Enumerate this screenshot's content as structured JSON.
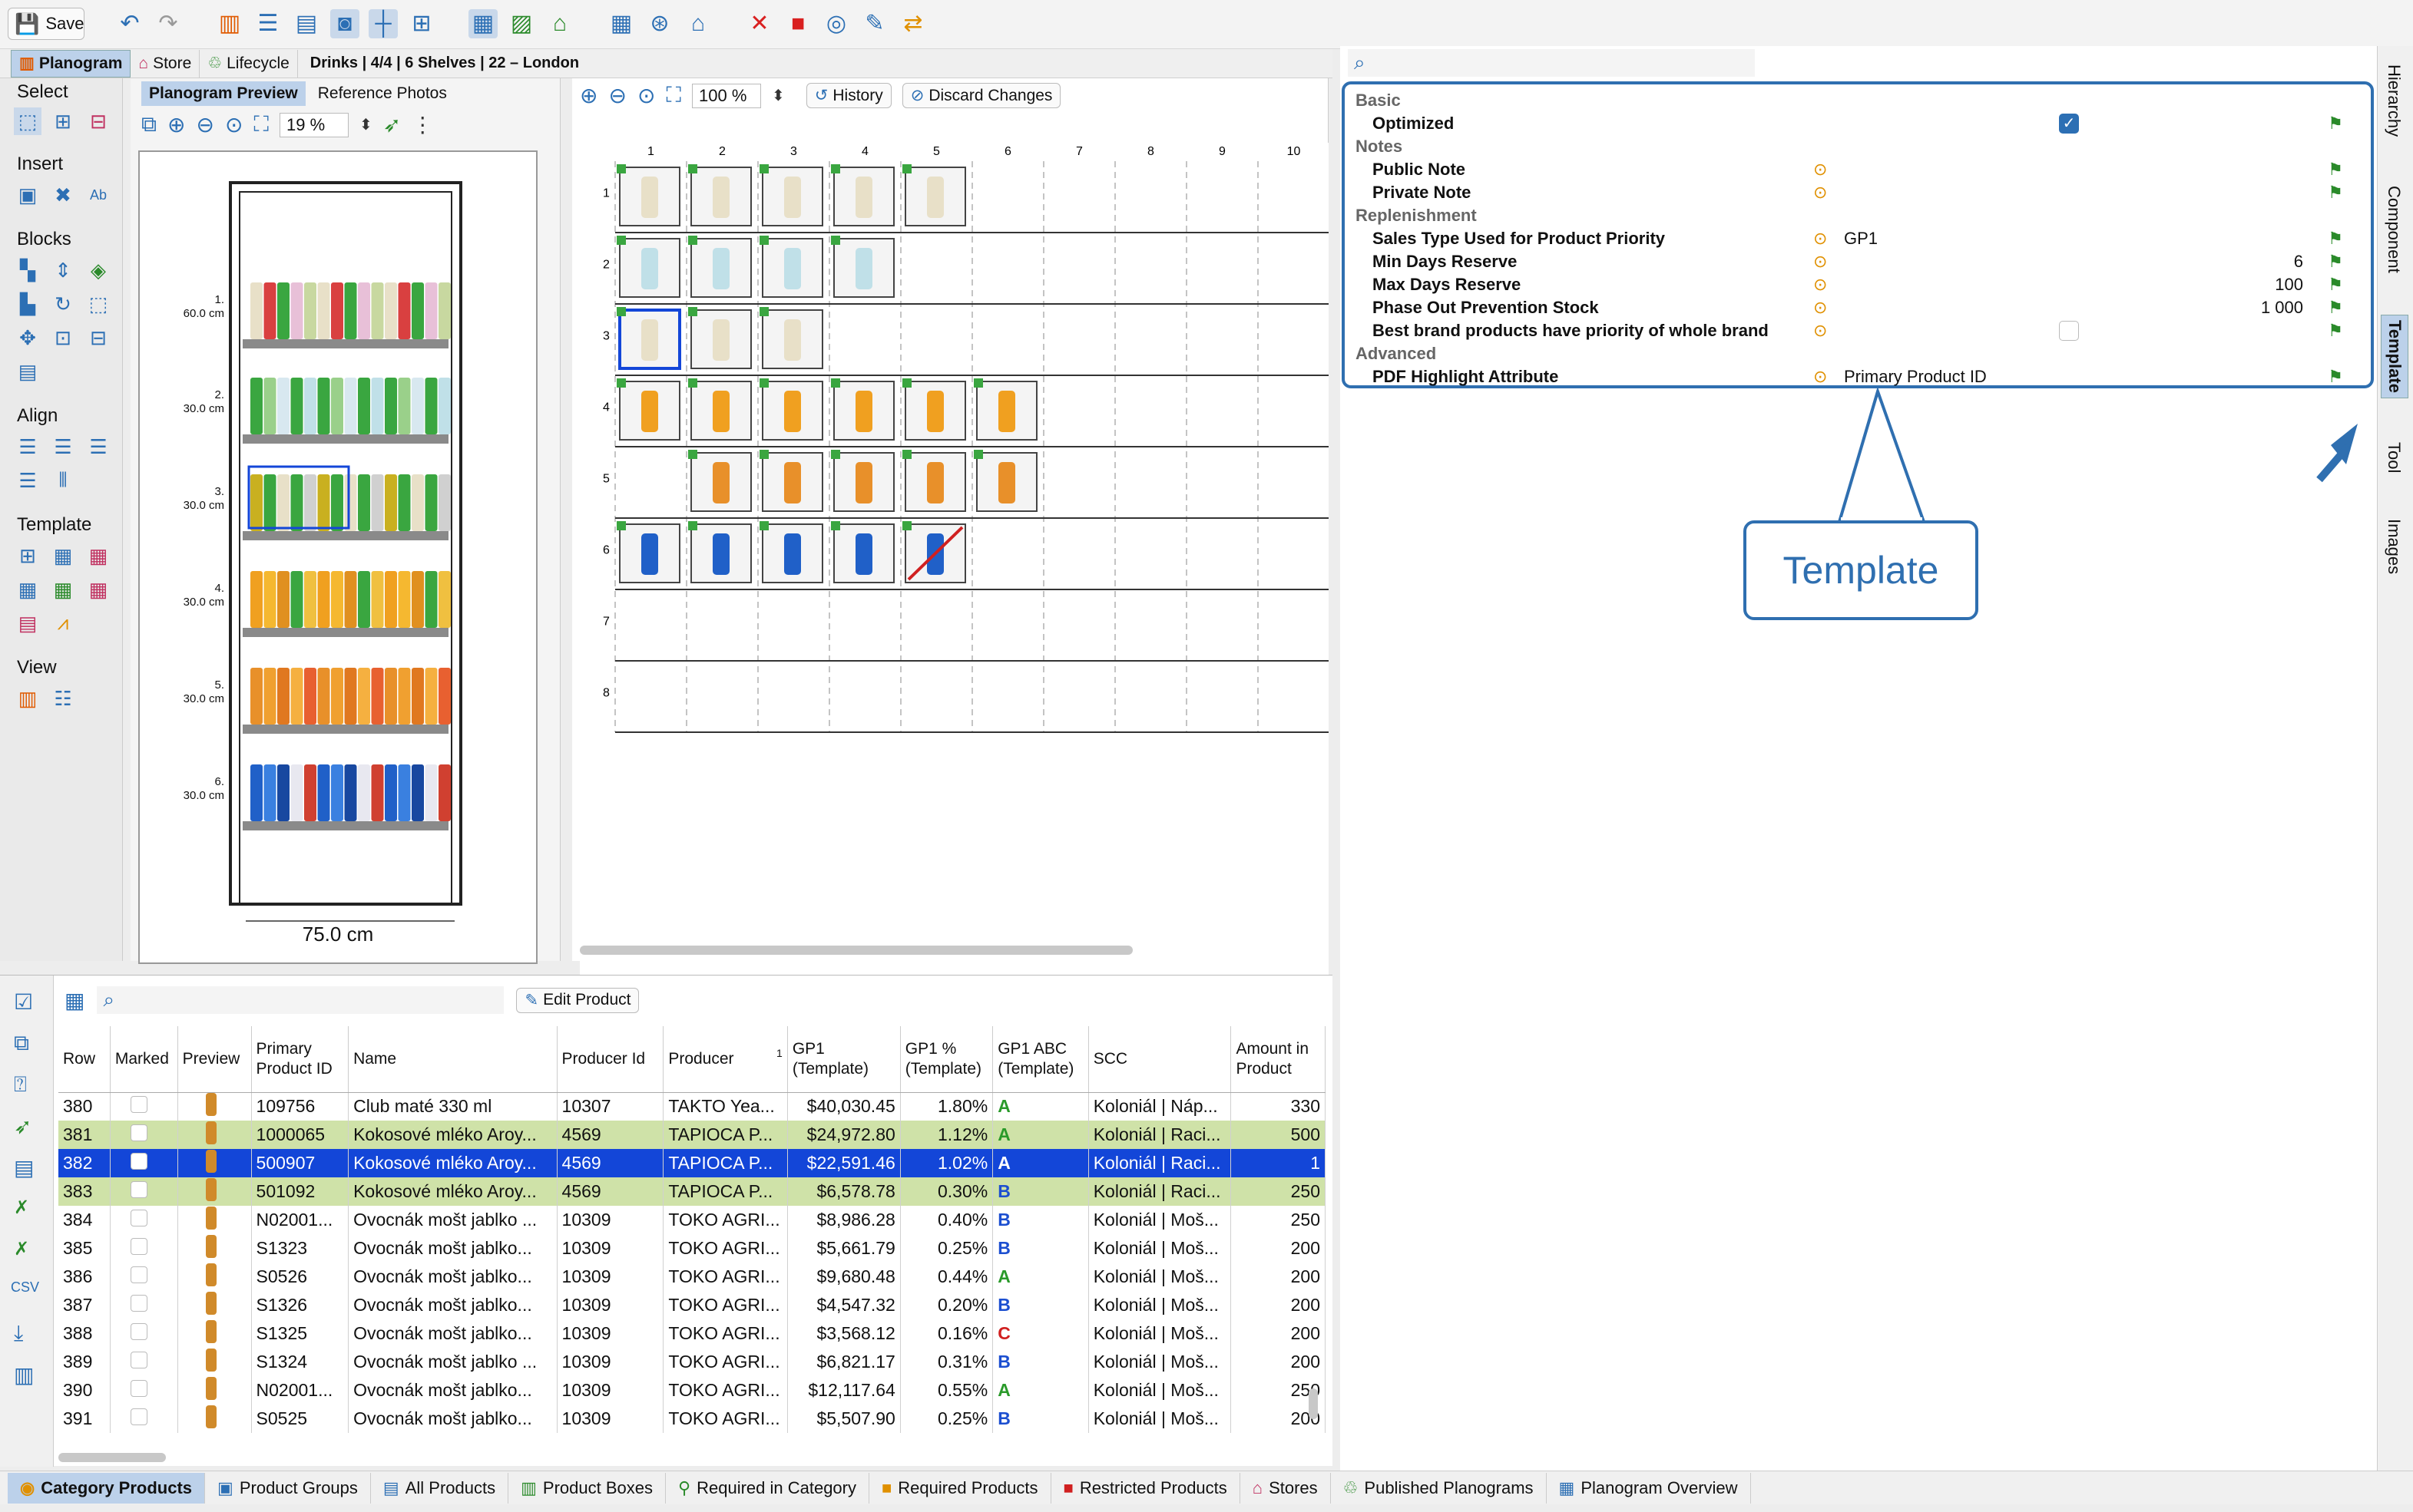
{
  "toolbar": {
    "save_label": "Save"
  },
  "top_tabs": [
    {
      "label": "Planogram",
      "icon": "planogram-icon"
    },
    {
      "label": "Store",
      "icon": "store-icon"
    },
    {
      "label": "Lifecycle",
      "icon": "lifecycle-icon"
    }
  ],
  "breadcrumb": "Drinks | 4/4 | 6 Shelves | 22 – London",
  "palette": {
    "select": "Select",
    "insert": "Insert",
    "blocks": "Blocks",
    "align": "Align",
    "template": "Template",
    "view": "View"
  },
  "preview": {
    "tab_preview": "Planogram Preview",
    "tab_photos": "Reference Photos",
    "zoom": "19 %",
    "shelves": [
      {
        "num": "1.",
        "height": "60.0 cm"
      },
      {
        "num": "2.",
        "height": "30.0 cm"
      },
      {
        "num": "3.",
        "height": "30.0 cm"
      },
      {
        "num": "4.",
        "height": "30.0 cm"
      },
      {
        "num": "5.",
        "height": "30.0 cm"
      },
      {
        "num": "6.",
        "height": "30.0 cm"
      }
    ],
    "width_label": "75.0 cm"
  },
  "grid": {
    "zoom": "100 %",
    "history": "History",
    "discard": "Discard Changes",
    "cols": [
      "1",
      "2",
      "3",
      "4",
      "5",
      "6",
      "7",
      "8",
      "9",
      "10"
    ],
    "rows": [
      "1",
      "2",
      "3",
      "4",
      "5",
      "6",
      "7",
      "8"
    ]
  },
  "props": {
    "sections": {
      "basic": "Basic",
      "notes": "Notes",
      "replenishment": "Replenishment",
      "advanced": "Advanced"
    },
    "optimized": "Optimized",
    "public_note": "Public Note",
    "private_note": "Private Note",
    "sales_type": "Sales Type Used for Product Priority",
    "sales_type_val": "GP1",
    "min_days": "Min Days Reserve",
    "min_days_val": "6",
    "max_days": "Max Days Reserve",
    "max_days_val": "100",
    "phase_out": "Phase Out Prevention Stock",
    "phase_out_val": "1 000",
    "best_brand": "Best brand products have priority of whole brand",
    "pdf_attr": "PDF Highlight Attribute",
    "pdf_attr_val": "Primary Product ID",
    "callout": "Template"
  },
  "vtabs": [
    "Hierarchy",
    "Component",
    "Template",
    "Tool",
    "Images"
  ],
  "table": {
    "edit_product": "Edit Product",
    "headers": [
      "Row",
      "Marked",
      "Preview",
      "Primary Product ID",
      "Name",
      "Producer Id",
      "Producer",
      "GP1 (Template)",
      "GP1 % (Template)",
      "GP1 ABC (Template)",
      "SCC",
      "Amount in Product"
    ],
    "sort_indicator": "1",
    "rows": [
      {
        "row": "380",
        "id": "109756",
        "name": "Club maté 330 ml",
        "pid": "10307",
        "producer": "TAKTO Yea...",
        "gp1": "$40,030.45",
        "gp1p": "1.80%",
        "abc": "A",
        "scc": "Koloniál | Náp...",
        "amount": "330",
        "style": ""
      },
      {
        "row": "381",
        "id": "1000065",
        "name": "Kokosové mléko Aroy...",
        "pid": "4569",
        "producer": "TAPIOCA P...",
        "gp1": "$24,972.80",
        "gp1p": "1.12%",
        "abc": "A",
        "scc": "Koloniál | Raci...",
        "amount": "500",
        "style": "green"
      },
      {
        "row": "382",
        "id": "500907",
        "name": "Kokosové mléko Aroy...",
        "pid": "4569",
        "producer": "TAPIOCA P...",
        "gp1": "$22,591.46",
        "gp1p": "1.02%",
        "abc": "A",
        "scc": "Koloniál | Raci...",
        "amount": "1",
        "style": "sel"
      },
      {
        "row": "383",
        "id": "501092",
        "name": "Kokosové mléko Aroy...",
        "pid": "4569",
        "producer": "TAPIOCA P...",
        "gp1": "$6,578.78",
        "gp1p": "0.30%",
        "abc": "B",
        "scc": "Koloniál | Raci...",
        "amount": "250",
        "style": "green"
      },
      {
        "row": "384",
        "id": "N02001...",
        "name": "Ovocnák mošt jablko ...",
        "pid": "10309",
        "producer": "TOKO AGRI...",
        "gp1": "$8,986.28",
        "gp1p": "0.40%",
        "abc": "B",
        "scc": "Koloniál | Moš...",
        "amount": "250",
        "style": ""
      },
      {
        "row": "385",
        "id": "S1323",
        "name": "Ovocnák mošt jablko...",
        "pid": "10309",
        "producer": "TOKO AGRI...",
        "gp1": "$5,661.79",
        "gp1p": "0.25%",
        "abc": "B",
        "scc": "Koloniál | Moš...",
        "amount": "200",
        "style": ""
      },
      {
        "row": "386",
        "id": "S0526",
        "name": "Ovocnák mošt jablko...",
        "pid": "10309",
        "producer": "TOKO AGRI...",
        "gp1": "$9,680.48",
        "gp1p": "0.44%",
        "abc": "A",
        "scc": "Koloniál | Moš...",
        "amount": "200",
        "style": ""
      },
      {
        "row": "387",
        "id": "S1326",
        "name": "Ovocnák mošt jablko...",
        "pid": "10309",
        "producer": "TOKO AGRI...",
        "gp1": "$4,547.32",
        "gp1p": "0.20%",
        "abc": "B",
        "scc": "Koloniál | Moš...",
        "amount": "200",
        "style": ""
      },
      {
        "row": "388",
        "id": "S1325",
        "name": "Ovocnák mošt jablko...",
        "pid": "10309",
        "producer": "TOKO AGRI...",
        "gp1": "$3,568.12",
        "gp1p": "0.16%",
        "abc": "C",
        "scc": "Koloniál | Moš...",
        "amount": "200",
        "style": ""
      },
      {
        "row": "389",
        "id": "S1324",
        "name": "Ovocnák mošt jablko ...",
        "pid": "10309",
        "producer": "TOKO AGRI...",
        "gp1": "$6,821.17",
        "gp1p": "0.31%",
        "abc": "B",
        "scc": "Koloniál | Moš...",
        "amount": "200",
        "style": ""
      },
      {
        "row": "390",
        "id": "N02001...",
        "name": "Ovocnák mošt jablko...",
        "pid": "10309",
        "producer": "TOKO AGRI...",
        "gp1": "$12,117.64",
        "gp1p": "0.55%",
        "abc": "A",
        "scc": "Koloniál | Moš...",
        "amount": "250",
        "style": ""
      },
      {
        "row": "391",
        "id": "S0525",
        "name": "Ovocnák mošt jablko...",
        "pid": "10309",
        "producer": "TOKO AGRI...",
        "gp1": "$5,507.90",
        "gp1p": "0.25%",
        "abc": "B",
        "scc": "Koloniál | Moš...",
        "amount": "200",
        "style": ""
      }
    ]
  },
  "bottom_tabs": [
    "Category Products",
    "Product Groups",
    "All Products",
    "Product Boxes",
    "Required in Category",
    "Required Products",
    "Restricted Products",
    "Stores",
    "Published Planograms",
    "Planogram Overview"
  ],
  "colors": {
    "accent": "#2c6fb4",
    "selection": "#1346d8",
    "highlight": "#cfe2a8",
    "abc_a": "#2a9a2a",
    "abc_b": "#1c4fd0",
    "abc_c": "#d02020"
  }
}
